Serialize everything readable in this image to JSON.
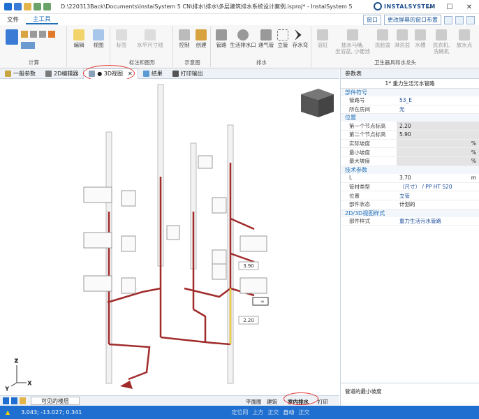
{
  "title": {
    "text": "D:\\220313Back\\Documents\\InstalSystem 5 CN\\排水\\排水\\多层建筑排水系统设计案例.isproj* - InstalSystem 5 Editor CN...",
    "logo": "INSTALSYSTEM",
    "minimize": "—",
    "maximize": "☐",
    "close": "✕"
  },
  "menu": {
    "file": "文件",
    "home": "主工具",
    "window_drop": "窗口",
    "layout_drop": "更改屏幕的窗口布置"
  },
  "ribbon": {
    "groups": {
      "calc": "计算",
      "label": "标注和图形",
      "sample": "示意图",
      "drain": "排水",
      "fixtures": "卫生器具和水龙头"
    },
    "buttons": {
      "edit": "编辑",
      "view": "视图",
      "mark": "标签",
      "dim": "水平尺寸线",
      "control": "控制",
      "create": "创建",
      "pipe": "管路",
      "cleanout": "生活排水口",
      "vent": "通气管",
      "riser": "立管",
      "trap": "存水弯",
      "bathtub": "浴缸",
      "toilet": "抽水马桶,\n坐浴盆, 小便池",
      "basin": "洗脸盆",
      "shower": "淋浴盆",
      "sink": "水槽",
      "washer": "洗衣机,\n洗碗机",
      "tap": "放水点"
    }
  },
  "tabs": [
    {
      "label": "一般参数"
    },
    {
      "label": "2D编辑器"
    },
    {
      "label": "● 3D视图"
    },
    {
      "label": "结果"
    },
    {
      "label": "打印输出"
    }
  ],
  "viewport": {
    "labels": {
      "dim1": "3.90",
      "dim2": "2.20",
      "dim3": "∞"
    },
    "axis": {
      "z": "Z",
      "x": "X",
      "y": "Y"
    }
  },
  "bottom_bar": {
    "floors": "可见的楼层",
    "plan": "平面图",
    "building": "建筑",
    "indoor": "室内排水",
    "print": "打印"
  },
  "status": {
    "coords": "3.043; -13.027; 0.341",
    "items": [
      "定位网",
      "上方",
      "正交",
      "自动",
      "正交"
    ]
  },
  "props": {
    "header": "参数表",
    "title": "1* 重力生活污水管路",
    "sections": {
      "part": "部件符号",
      "pos": "位置",
      "tech": "技术参数",
      "style": "2D/3D视图样式"
    },
    "rows": {
      "pipe_no": {
        "k": "管路号",
        "v": "53_E"
      },
      "room": {
        "k": "所在房间",
        "v": "无"
      },
      "n1": {
        "k": "第一个节点标高",
        "v": "2.20"
      },
      "n2": {
        "k": "第二个节点标高",
        "v": "5.90"
      },
      "slope": {
        "k": "实际坡度",
        "v": "%"
      },
      "minslope": {
        "k": "最小坡度",
        "v": "%"
      },
      "maxslope": {
        "k": "最大坡度",
        "v": "%"
      },
      "len": {
        "k": "L",
        "v": "3.70",
        "u": "m"
      },
      "type": {
        "k": "管材类型",
        "v": "（尺寸） / PP HT S20"
      },
      "place": {
        "k": "位置",
        "v": "立管"
      },
      "state": {
        "k": "部件状态",
        "v": "计划的"
      },
      "style": {
        "k": "部件样式",
        "v": "重力生活污水管路"
      }
    },
    "footer": "管道的最小坡度"
  },
  "colors": {
    "accent": "#1e6fd0",
    "pipe": "#a12b2b",
    "vent": "#e0a060",
    "highlight": "#e53935"
  }
}
